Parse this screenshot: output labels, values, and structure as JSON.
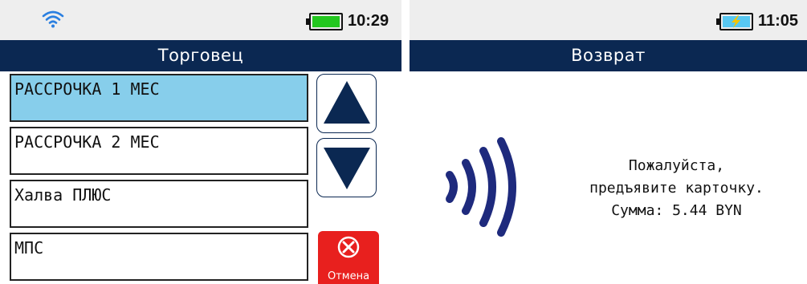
{
  "left_screen": {
    "status": {
      "time": "10:29",
      "wifi_icon": "wifi-icon",
      "battery_icon": "battery-full-icon",
      "battery_color": "#23c71f"
    },
    "title": "Торговец",
    "items": [
      {
        "label": "РАССРОЧКА 1 МЕС",
        "selected": true
      },
      {
        "label": "РАССРОЧКА 2 МЕС",
        "selected": false
      },
      {
        "label": "Халва ПЛЮС",
        "selected": false
      },
      {
        "label": "МПС",
        "selected": false
      }
    ],
    "scroll_up_icon": "arrow-up-icon",
    "scroll_down_icon": "arrow-down-icon",
    "cancel": {
      "label": "Отмена",
      "icon": "close-circle-icon",
      "color": "#e8201e"
    }
  },
  "right_screen": {
    "status": {
      "time": "11:05",
      "battery_icon": "battery-charging-icon",
      "battery_color": "#58c8f2"
    },
    "title": "Возврат",
    "contactless_icon": "contactless-icon",
    "message": {
      "line1": "Пожалуйста,",
      "line2": "предъявите карточку.",
      "line3": "Сумма: 5.44 BYN"
    }
  },
  "colors": {
    "header_bg": "#0b2852",
    "selected_bg": "#87ceeb",
    "status_bg": "#eeeeee"
  }
}
